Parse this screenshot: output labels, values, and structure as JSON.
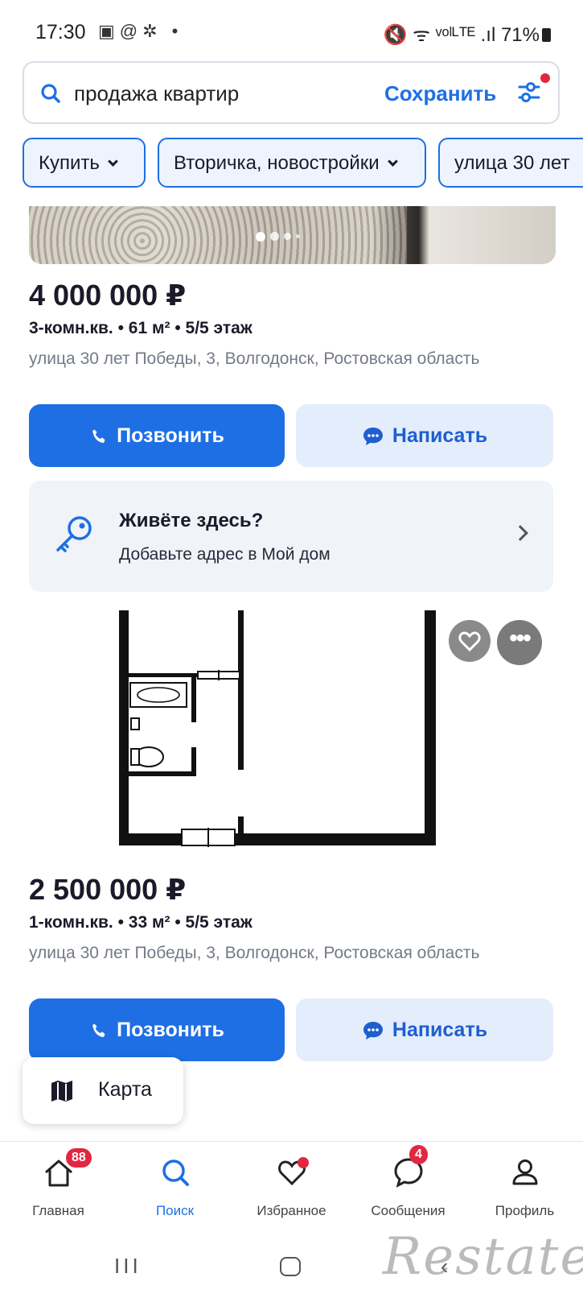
{
  "status_bar": {
    "time": "17:30",
    "notif_icons": "▣@✲ •",
    "right": "🔇 ᯤ ᵛᵒˡᴸᵀᴱ .ıl 71%"
  },
  "search": {
    "query": "продажа квартир",
    "save_label": "Сохранить"
  },
  "chips": [
    {
      "label": "Купить"
    },
    {
      "label": "Вторичка, новостройки"
    },
    {
      "label": "улица 30 лет"
    }
  ],
  "listings": [
    {
      "price": "4 000 000 ₽",
      "specs": "3-комн.кв. • 61 м² • 5/5 этаж",
      "address": "улица 30 лет Победы, 3, Волгодонск, Ростовская область",
      "call_label": "Позвонить",
      "message_label": "Написать"
    },
    {
      "price": "2 500 000 ₽",
      "specs": "1-комн.кв. • 33 м² • 5/5 этаж",
      "address": "улица 30 лет Победы, 3, Волгодонск, Ростовская область",
      "call_label": "Позвонить",
      "message_label": "Написать"
    }
  ],
  "live_here": {
    "title": "Живёте здесь?",
    "subtitle": "Добавьте адрес в Мой дом"
  },
  "map_button": {
    "label": "Карта"
  },
  "nav": [
    {
      "label": "Главная",
      "icon": "home-icon",
      "badge": "88"
    },
    {
      "label": "Поиск",
      "icon": "search-icon",
      "active": true
    },
    {
      "label": "Избранное",
      "icon": "heart-icon"
    },
    {
      "label": "Сообщения",
      "icon": "chat-icon",
      "badge": "4"
    },
    {
      "label": "Профиль",
      "icon": "profile-icon"
    }
  ],
  "watermark": "Restate",
  "colors": {
    "accent": "#1e6fe3",
    "badge": "#e02940",
    "secondary_btn": "#e3edfb"
  }
}
